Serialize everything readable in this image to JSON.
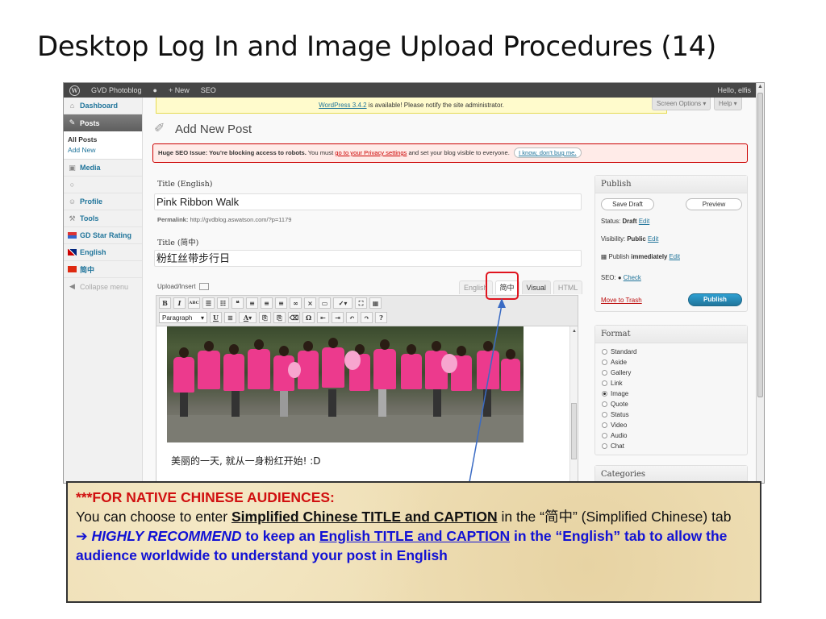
{
  "slide": {
    "title": "Desktop Log In and Image Upload Procedures (14)"
  },
  "adminbar": {
    "site": "GVD Photoblog",
    "new": "+ New",
    "seo": "SEO",
    "greeting": "Hello, elfis"
  },
  "sidebar": {
    "dashboard": "Dashboard",
    "posts": "Posts",
    "all_posts": "All Posts",
    "add_new": "Add New",
    "media": "Media",
    "profile": "Profile",
    "tools": "Tools",
    "gd_star": "GD Star Rating",
    "english": "English",
    "chinese": "简中",
    "collapse": "Collapse menu"
  },
  "notice": {
    "link": "WordPress 3.4.2",
    "text": " is available! Please notify the site administrator."
  },
  "screen_options": "Screen Options ▾",
  "help": "Help ▾",
  "page_title": "Add New Post",
  "seo_warning": {
    "bold": "Huge SEO Issue: You're blocking access to robots.",
    "text1": " You must ",
    "link": "go to your Privacy settings",
    "text2": " and set your blog visible to everyone.",
    "dismiss": "I know, don't bug me."
  },
  "title_en": {
    "label": "Title (English)",
    "value": "Pink Ribbon Walk"
  },
  "permalink": {
    "label": "Permalink:",
    "url": " http://gvdblog.aswatson.com/?p=1179"
  },
  "title_cn": {
    "label": "Title (简中)",
    "value": "粉红丝带步行日"
  },
  "upload_insert": "Upload/Insert",
  "tabs": {
    "english": "English",
    "chinese": "简中",
    "visual": "Visual",
    "html": "HTML"
  },
  "toolbar": {
    "paragraph": "Paragraph"
  },
  "caption": "美丽的一天, 就从一身粉红开始! :D",
  "publish": {
    "heading": "Publish",
    "save_draft": "Save Draft",
    "preview": "Preview",
    "status_label": "Status: ",
    "status_value": "Draft",
    "edit": "Edit",
    "visibility_label": "Visibility: ",
    "visibility_value": "Public",
    "publish_label": "Publish ",
    "publish_value": "immediately",
    "seo_label": "SEO: ",
    "check": "Check",
    "trash": "Move to Trash",
    "publish_btn": "Publish"
  },
  "format": {
    "heading": "Format",
    "options": [
      "Standard",
      "Aside",
      "Gallery",
      "Link",
      "Image",
      "Quote",
      "Status",
      "Video",
      "Audio",
      "Chat"
    ],
    "selected": "Image"
  },
  "categories": {
    "heading": "Categories"
  },
  "note": {
    "heading": "***FOR NATIVE CHINESE AUDIENCES:",
    "line1_a": "You can choose to enter ",
    "line1_b": "Simplified Chinese TITLE and CAPTION",
    "line1_c": " in the “简中” (Simplified Chinese) tab",
    "arrow": "➔ ",
    "recommend": "HIGHLY RECOMMEND",
    "line2_a": " to keep an ",
    "line2_b": "English TITLE and CAPTION",
    "line2_c": " in the “English” tab to allow the audience worldwide to understand your post in English"
  },
  "colors": {
    "highlight": "#e0141e",
    "accent_blue": "#21759b",
    "note_red": "#d01010",
    "note_blue": "#1212d4"
  }
}
